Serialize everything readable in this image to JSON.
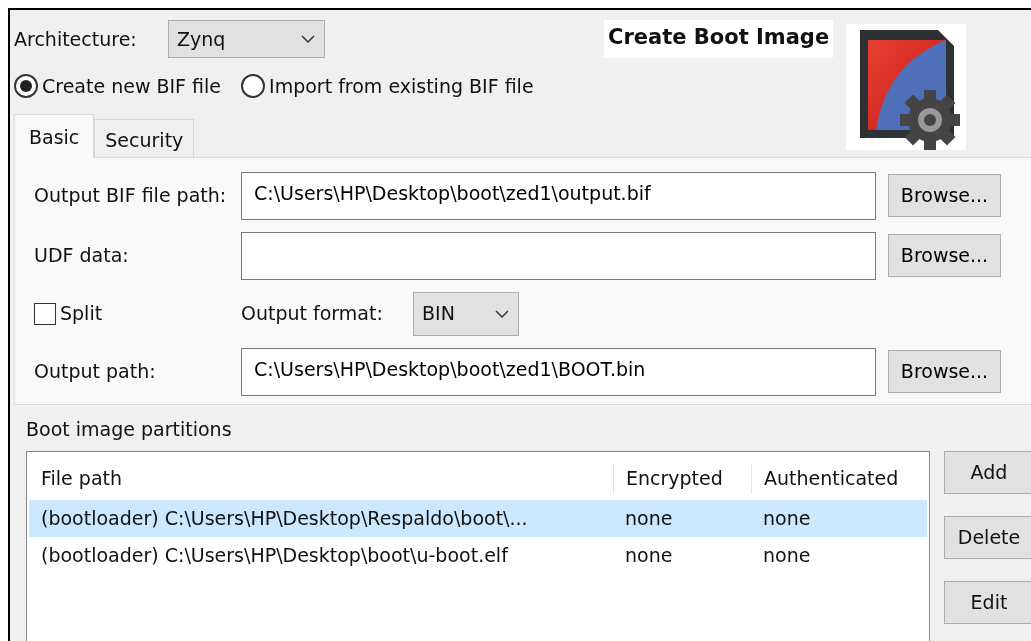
{
  "architecture": {
    "label": "Architecture:",
    "value": "Zynq"
  },
  "header": {
    "title": "Create Boot Image"
  },
  "mode_options": [
    {
      "label": "Create new BIF file",
      "selected": true
    },
    {
      "label": "Import from existing BIF file",
      "selected": false
    }
  ],
  "tabs": [
    {
      "label": "Basic",
      "selected": true
    },
    {
      "label": "Security",
      "selected": false
    }
  ],
  "basic": {
    "output_bif": {
      "label": "Output BIF file path:",
      "value": "C:\\Users\\HP\\Desktop\\boot\\zed1\\output.bif",
      "button": "Browse..."
    },
    "udf": {
      "label": "UDF data:",
      "button": "Browse..."
    },
    "split": {
      "label": "Split",
      "checked": false
    },
    "output_format": {
      "label": "Output format:",
      "value": "BIN"
    },
    "output_path": {
      "label": "Output path:",
      "value": "C:\\Users\\HP\\Desktop\\boot\\zed1\\BOOT.bin",
      "button": "Browse..."
    }
  },
  "partitions": {
    "title": "Boot image partitions",
    "columns": [
      "File path",
      "Encrypted",
      "Authenticated"
    ],
    "rows": [
      {
        "cells": [
          "(bootloader) C:\\Users\\HP\\Desktop\\Respaldo\\boot\\...",
          "none",
          "none"
        ],
        "selected": true
      },
      {
        "cells": [
          "(bootloader) C:\\Users\\HP\\Desktop\\boot\\u-boot.elf",
          "none",
          "none"
        ],
        "selected": false
      }
    ],
    "buttons": [
      "Add",
      "Delete",
      "Edit"
    ]
  }
}
